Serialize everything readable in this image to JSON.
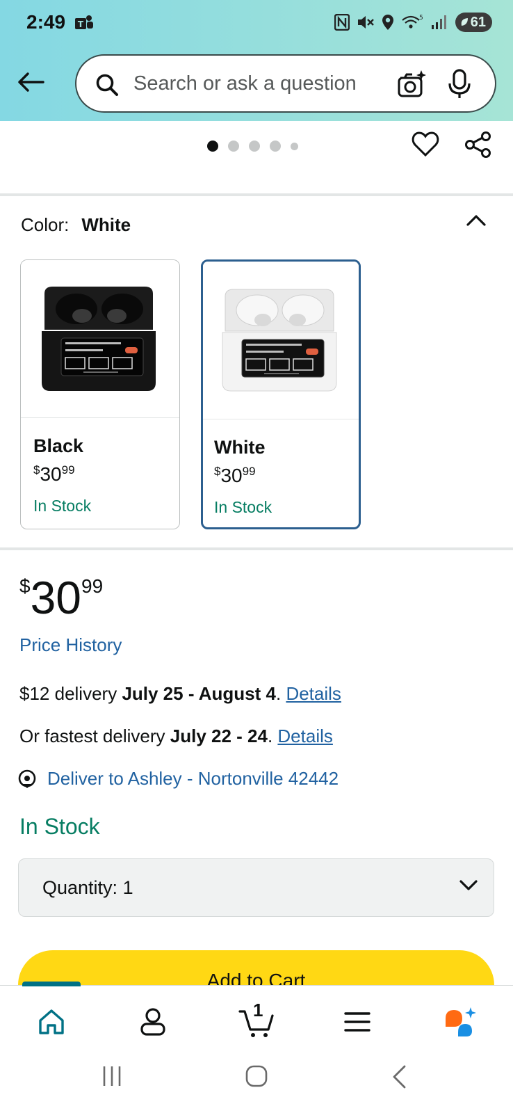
{
  "status_bar": {
    "time": "2:49",
    "battery": "61"
  },
  "search": {
    "placeholder": "Search or ask a question"
  },
  "gallery": {
    "dots_count": 5,
    "active_index": 0
  },
  "color_selector": {
    "label": "Color:",
    "selected": "White",
    "options": [
      {
        "name": "Black",
        "price_symbol": "$",
        "price_whole": "30",
        "price_fraction": "99",
        "stock": "In Stock",
        "selected": false
      },
      {
        "name": "White",
        "price_symbol": "$",
        "price_whole": "30",
        "price_fraction": "99",
        "stock": "In Stock",
        "selected": true
      }
    ]
  },
  "price": {
    "symbol": "$",
    "whole": "30",
    "fraction": "99",
    "history_link": "Price History"
  },
  "delivery": {
    "standard_prefix": "$12 delivery",
    "standard_dates": "July 25 - August 4",
    "fastest_prefix": "Or fastest delivery",
    "fastest_dates": "July 22 - 24",
    "details_link": "Details",
    "deliver_to": "Deliver to Ashley - Nortonville 42442"
  },
  "availability": "In Stock",
  "quantity": {
    "label": "Quantity:",
    "value": "1"
  },
  "add_to_cart": "Add to Cart",
  "bottom_nav": {
    "cart_count": "1"
  },
  "colors": {
    "accent_link": "#2162a1",
    "stock_green": "#067d62",
    "cart_yellow": "#ffd814",
    "selected_border": "#2c5f8f"
  }
}
